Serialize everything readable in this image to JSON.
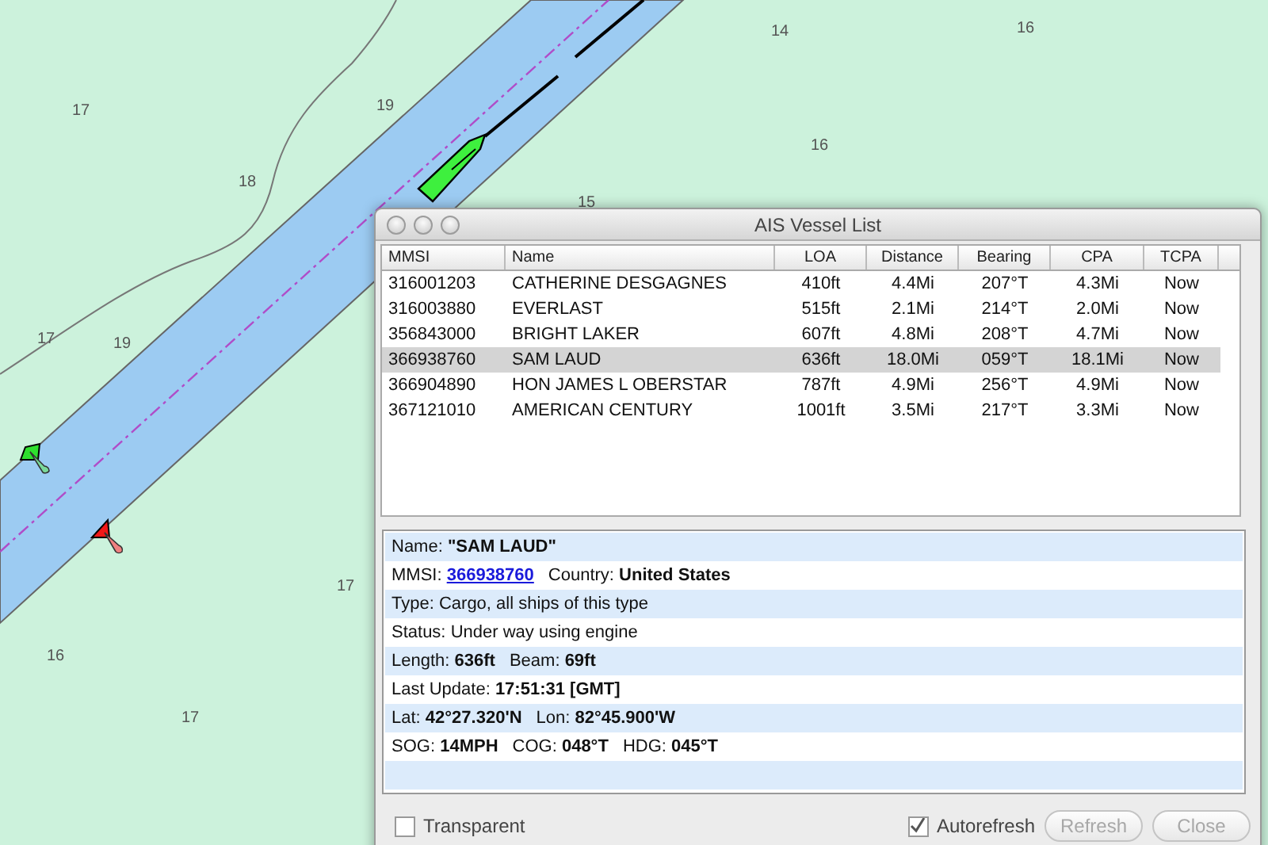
{
  "map": {
    "soundings": [
      "17",
      "19",
      "18",
      "14",
      "16",
      "16",
      "15",
      "17",
      "19",
      "17",
      "16",
      "17"
    ]
  },
  "window": {
    "title": "AIS Vessel List"
  },
  "table": {
    "columns": [
      "MMSI",
      "Name",
      "LOA",
      "Distance",
      "Bearing",
      "CPA",
      "TCPA"
    ],
    "rows": [
      {
        "cells": [
          "316001203",
          "CATHERINE DESGAGNES",
          "410ft",
          "4.4Mi",
          "207°T",
          "4.3Mi",
          "Now"
        ],
        "selected": false
      },
      {
        "cells": [
          "316003880",
          "EVERLAST",
          "515ft",
          "2.1Mi",
          "214°T",
          "2.0Mi",
          "Now"
        ],
        "selected": false
      },
      {
        "cells": [
          "356843000",
          "BRIGHT LAKER",
          "607ft",
          "4.8Mi",
          "208°T",
          "4.7Mi",
          "Now"
        ],
        "selected": false
      },
      {
        "cells": [
          "366938760",
          "SAM LAUD",
          "636ft",
          "18.0Mi",
          "059°T",
          "18.1Mi",
          "Now"
        ],
        "selected": true
      },
      {
        "cells": [
          "366904890",
          "HON JAMES L OBERSTAR",
          "787ft",
          "4.9Mi",
          "256°T",
          "4.9Mi",
          "Now"
        ],
        "selected": false
      },
      {
        "cells": [
          "367121010",
          "AMERICAN CENTURY",
          "1001ft",
          "3.5Mi",
          "217°T",
          "3.3Mi",
          "Now"
        ],
        "selected": false
      }
    ]
  },
  "details": {
    "lines": [
      {
        "fields": [
          {
            "label": "Name:",
            "value": "\"SAM LAUD\"",
            "kind": "bold"
          }
        ]
      },
      {
        "fields": [
          {
            "label": "MMSI:",
            "value": "366938760",
            "kind": "link"
          },
          {
            "label": "Country:",
            "value": "United States",
            "kind": "bold"
          }
        ]
      },
      {
        "fields": [
          {
            "label": "Type:",
            "value": "Cargo, all ships of this type",
            "kind": "plain"
          }
        ]
      },
      {
        "fields": [
          {
            "label": "Status:",
            "value": "Under way using engine",
            "kind": "plain"
          }
        ]
      },
      {
        "fields": [
          {
            "label": "Length:",
            "value": "636ft",
            "kind": "bold"
          },
          {
            "label": "Beam:",
            "value": "69ft",
            "kind": "bold"
          }
        ]
      },
      {
        "fields": [
          {
            "label": "Last Update:",
            "value": "17:51:31 [GMT]",
            "kind": "bold"
          }
        ]
      },
      {
        "fields": [
          {
            "label": "Lat:",
            "value": "42°27.320'N",
            "kind": "bold"
          },
          {
            "label": "Lon:",
            "value": "82°45.900'W",
            "kind": "bold"
          }
        ]
      },
      {
        "fields": [
          {
            "label": "SOG:",
            "value": "14MPH",
            "kind": "bold"
          },
          {
            "label": "COG:",
            "value": "048°T",
            "kind": "bold"
          },
          {
            "label": "HDG:",
            "value": "045°T",
            "kind": "bold"
          }
        ]
      }
    ]
  },
  "options": [
    {
      "label": "Transparent",
      "checked": false
    },
    {
      "label": "Autorefresh",
      "checked": true
    }
  ],
  "buttons": [
    {
      "label": "Refresh",
      "disabled": true
    },
    {
      "label": "Close",
      "disabled": true
    }
  ]
}
